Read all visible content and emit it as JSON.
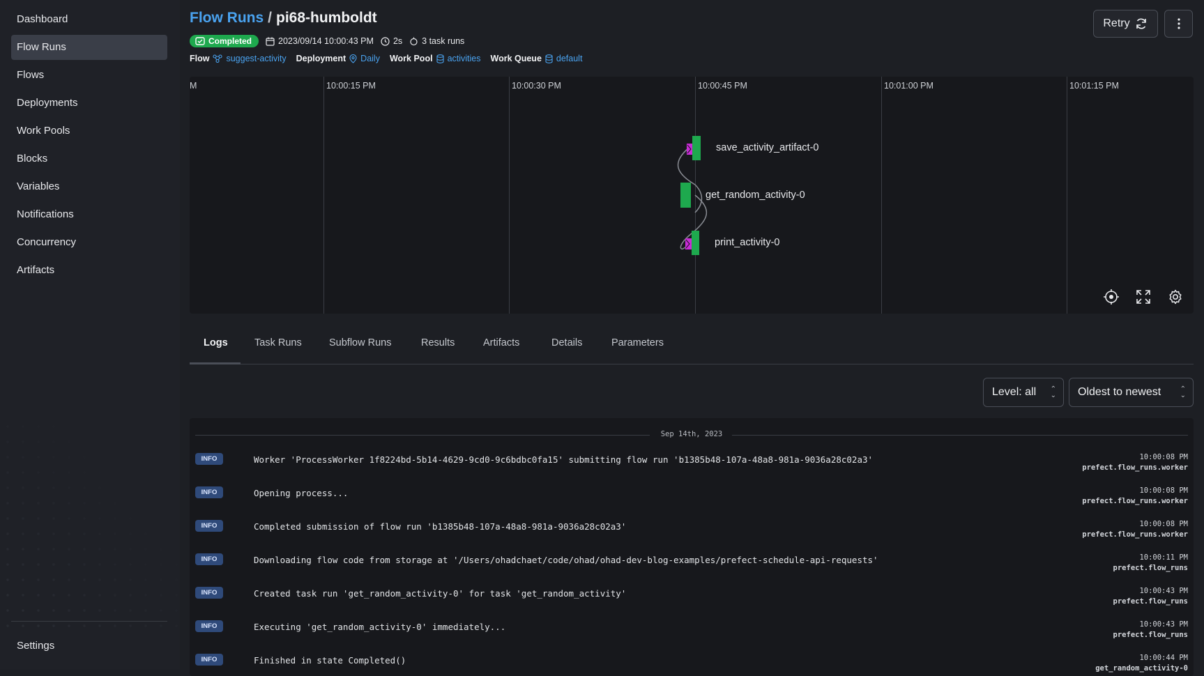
{
  "sidebar": {
    "items": [
      {
        "label": "Dashboard"
      },
      {
        "label": "Flow Runs",
        "active": true
      },
      {
        "label": "Flows"
      },
      {
        "label": "Deployments"
      },
      {
        "label": "Work Pools"
      },
      {
        "label": "Blocks"
      },
      {
        "label": "Variables"
      },
      {
        "label": "Notifications"
      },
      {
        "label": "Concurrency"
      },
      {
        "label": "Artifacts"
      }
    ],
    "settings_label": "Settings"
  },
  "header": {
    "breadcrumb": "Flow Runs",
    "separator": "/",
    "run_name": "pi68-humboldt",
    "status": "Completed",
    "start_time": "2023/09/14 10:00:43 PM",
    "duration": "2s",
    "task_runs": "3 task runs",
    "flow_label": "Flow",
    "flow_value": "suggest-activity",
    "deployment_label": "Deployment",
    "deployment_value": "Daily",
    "work_pool_label": "Work Pool",
    "work_pool_value": "activities",
    "work_queue_label": "Work Queue",
    "work_queue_value": "default",
    "retry_label": "Retry"
  },
  "timeline": {
    "tick_labels": [
      "M",
      "10:00:15 PM",
      "10:00:30 PM",
      "10:00:45 PM",
      "10:01:00 PM",
      "10:01:15 PM"
    ],
    "nodes": [
      {
        "label": "save_activity_artifact-0",
        "state": "Completed"
      },
      {
        "label": "get_random_activity-0",
        "state": "Completed"
      },
      {
        "label": "print_activity-0",
        "state": "Completed"
      }
    ],
    "colors": {
      "completed": "#1ea94e",
      "cached": "#c82bd6",
      "edge": "#8a8d94"
    }
  },
  "tabs": [
    {
      "label": "Logs",
      "active": true
    },
    {
      "label": "Task Runs"
    },
    {
      "label": "Subflow Runs"
    },
    {
      "label": "Results"
    },
    {
      "label": "Artifacts"
    },
    {
      "label": "Details"
    },
    {
      "label": "Parameters"
    }
  ],
  "filters": {
    "level": "Level: all",
    "sort": "Oldest to newest"
  },
  "logs": {
    "date": "Sep 14th, 2023",
    "entries": [
      {
        "level": "INFO",
        "message": "Worker 'ProcessWorker 1f8224bd-5b14-4629-9cd0-9c6bdbc0fa15' submitting flow run 'b1385b48-107a-48a8-981a-9036a28c02a3'",
        "time": "10:00:08 PM",
        "source": "prefect.flow_runs.worker"
      },
      {
        "level": "INFO",
        "message": "Opening process...",
        "time": "10:00:08 PM",
        "source": "prefect.flow_runs.worker"
      },
      {
        "level": "INFO",
        "message": "Completed submission of flow run 'b1385b48-107a-48a8-981a-9036a28c02a3'",
        "time": "10:00:08 PM",
        "source": "prefect.flow_runs.worker"
      },
      {
        "level": "INFO",
        "message": "Downloading flow code from storage at '/Users/ohadchaet/code/ohad/ohad-dev-blog-examples/prefect-schedule-api-requests'",
        "time": "10:00:11 PM",
        "source": "prefect.flow_runs"
      },
      {
        "level": "INFO",
        "message": "Created task run 'get_random_activity-0' for task 'get_random_activity'",
        "time": "10:00:43 PM",
        "source": "prefect.flow_runs"
      },
      {
        "level": "INFO",
        "message": "Executing 'get_random_activity-0' immediately...",
        "time": "10:00:43 PM",
        "source": "prefect.flow_runs"
      },
      {
        "level": "INFO",
        "message": "Finished in state Completed()",
        "time": "10:00:44 PM",
        "source": "get_random_activity-0"
      }
    ]
  },
  "accent": "#4aa3f0",
  "success": "#1ea94e"
}
